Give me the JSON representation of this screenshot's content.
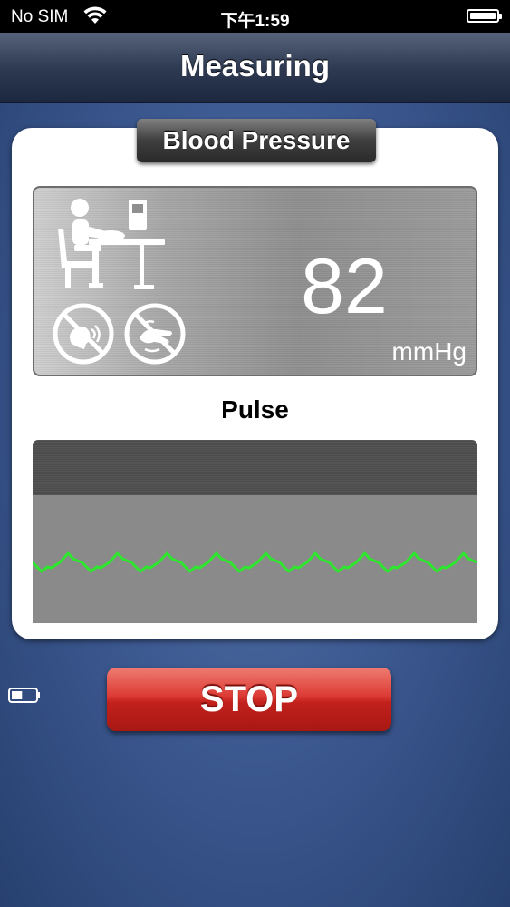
{
  "status_bar": {
    "carrier": "No SIM",
    "time": "下午1:59",
    "icons": [
      "wifi-icon",
      "battery-icon"
    ]
  },
  "nav": {
    "title": "Measuring"
  },
  "card": {
    "tab_title": "Blood Pressure",
    "icons": [
      "seated-posture-icon",
      "no-talking-icon",
      "no-moving-icon"
    ],
    "reading": {
      "value": "82",
      "unit": "mmHg"
    },
    "pulse_label": "Pulse",
    "pulse_wave": {
      "color": "#2ee62e",
      "beats": 9,
      "note_icon": "pulse-waveform"
    }
  },
  "device_battery": {
    "icon": "device-battery-icon",
    "level": 0.45
  },
  "stop_button": {
    "label": "STOP",
    "color": "#d9302a"
  },
  "colors": {
    "background": "#3d5a92",
    "nav_bar": "#2f3b52",
    "card": "#ffffff",
    "panel": "#9b9b9b"
  }
}
